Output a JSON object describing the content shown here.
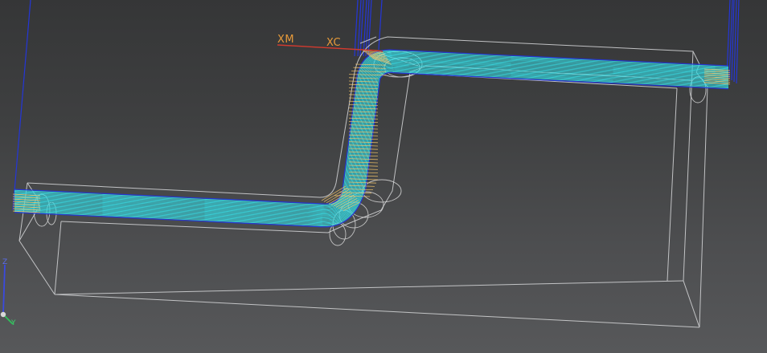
{
  "viewport": {
    "background_top": "#353637",
    "background_bottom": "#57585a"
  },
  "csys": {
    "xm_label": "XM",
    "xc_label": "XC",
    "label_color": "#e79a3a",
    "axis_color": "#d23a2e"
  },
  "triad": {
    "z_label": "Z",
    "y_label": "Y",
    "z_color": "#3a4ae0",
    "y_color": "#2fc05a"
  },
  "colors": {
    "part_edges": "#cfd0d2",
    "toolpath_cut": "#37d6de",
    "toolpath_engage": "#f3c46a",
    "toolpath_rapid": "#2436d8",
    "tool_outline": "#d9d9d9"
  }
}
